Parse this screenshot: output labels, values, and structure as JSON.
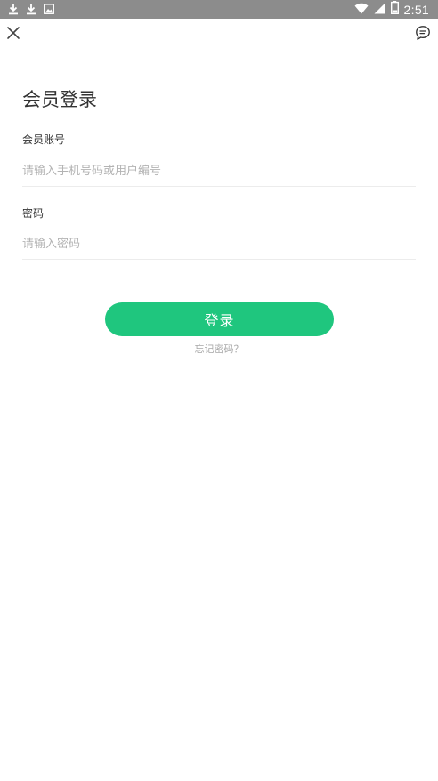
{
  "status_bar": {
    "time": "2:51",
    "battery_level": "2",
    "left_icons": [
      "download-icon",
      "download-icon",
      "image-icon"
    ],
    "right_icons": [
      "wifi-icon",
      "cell-signal-icon",
      "battery-icon"
    ]
  },
  "header": {
    "close_icon": "close-icon",
    "message_icon": "chat-bubble-icon"
  },
  "page": {
    "title": "会员登录"
  },
  "form": {
    "account": {
      "label": "会员账号",
      "placeholder": "请输入手机号码或用户编号",
      "value": ""
    },
    "password": {
      "label": "密码",
      "placeholder": "请输入密码",
      "value": ""
    },
    "login_label": "登录",
    "forgot_label": "忘记密码？"
  },
  "colors": {
    "accent": "#1fc67e",
    "statusbar": "#8c8c8c",
    "text_primary": "#333333",
    "placeholder": "#b3b3b3"
  }
}
